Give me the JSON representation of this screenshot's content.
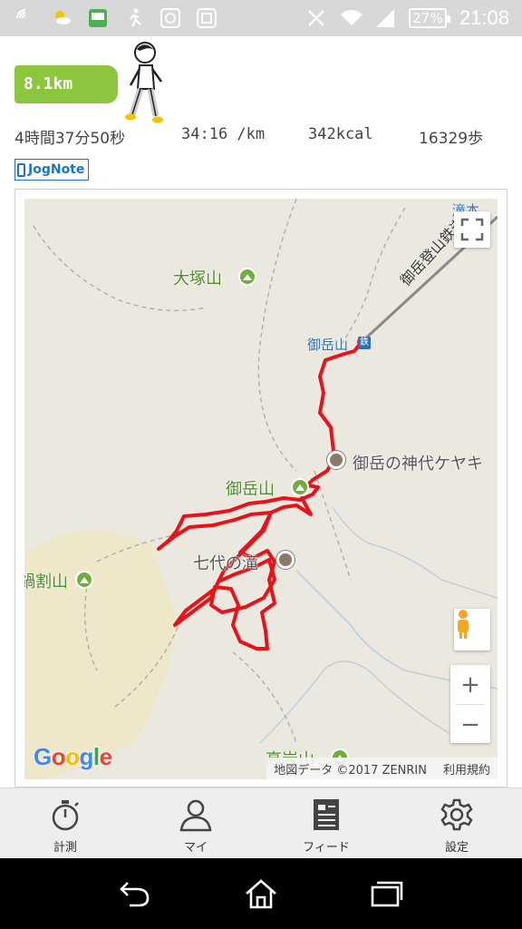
{
  "status_bar": {
    "time": "21:08",
    "battery_percent": "27%",
    "icons": [
      "nfc-icon",
      "weather-icon",
      "nikon-app-icon",
      "runner-icon",
      "fan-icon",
      "camera-app-icon",
      "silent-icon",
      "wifi-icon",
      "signal-icon",
      "battery-icon"
    ]
  },
  "workout": {
    "distance": "8.1km",
    "time": "4時間37分50秒",
    "pace": "34:16 /km",
    "calories": "342kcal",
    "steps": "16329歩",
    "source_label": "JogNote"
  },
  "map": {
    "peaks": [
      {
        "name": "大塚山"
      },
      {
        "name": "御岳山"
      },
      {
        "name": "鍋割山"
      },
      {
        "name": "高岩山"
      }
    ],
    "pois": [
      {
        "name": "御岳の神代ケヤキ"
      },
      {
        "name": "七代の滝"
      }
    ],
    "stations": [
      {
        "name": "御岳山"
      },
      {
        "name": "滝本"
      }
    ],
    "railway_label": "御岳登山鉄道",
    "zoom_in_label": "+",
    "zoom_out_label": "−",
    "logo": "Google",
    "attribution": "地図データ ©2017 ZENRIN",
    "terms_link": "利用規約",
    "route_color": "#e8131a"
  },
  "tabs": [
    {
      "label": "計測",
      "icon": "stopwatch-icon"
    },
    {
      "label": "マイ",
      "icon": "person-icon"
    },
    {
      "label": "フィード",
      "icon": "feed-icon"
    },
    {
      "label": "設定",
      "icon": "gear-icon"
    }
  ],
  "colors": {
    "accent_green": "#8cc63f",
    "jognote_blue": "#1e73c8"
  }
}
